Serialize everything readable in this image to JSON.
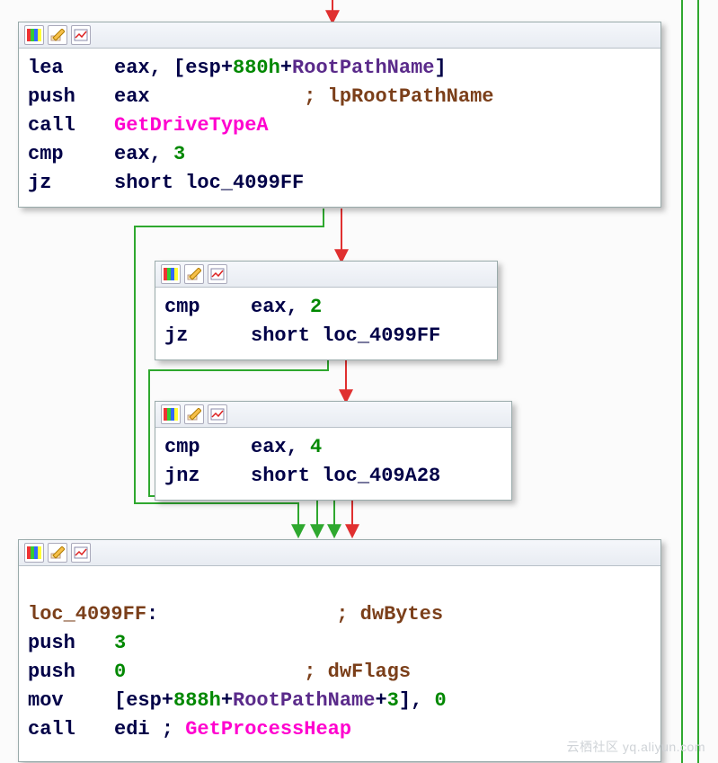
{
  "icons": {
    "colors": "color-bars-icon",
    "edit": "edit-icon",
    "graph": "graph-icon"
  },
  "nodes": {
    "n0": {
      "lines": [
        [
          {
            "t": "lea",
            "c": "mn"
          },
          {
            "t": "eax, [esp+",
            "c": "reg"
          },
          {
            "t": "880h",
            "c": "num"
          },
          {
            "t": "+",
            "c": "reg"
          },
          {
            "t": "RootPathName",
            "c": "vio"
          },
          {
            "t": "]",
            "c": "reg"
          }
        ],
        [
          {
            "t": "push",
            "c": "mn"
          },
          {
            "t": "eax             ",
            "c": "reg"
          },
          {
            "t": "; lpRootPathName",
            "c": "cmt"
          }
        ],
        [
          {
            "t": "call",
            "c": "mn"
          },
          {
            "t": "GetDriveTypeA",
            "c": "api"
          }
        ],
        [
          {
            "t": "cmp",
            "c": "mn"
          },
          {
            "t": "eax, ",
            "c": "reg"
          },
          {
            "t": "3",
            "c": "num"
          }
        ],
        [
          {
            "t": "jz",
            "c": "mn"
          },
          {
            "t": "short loc_4099FF",
            "c": "reg"
          }
        ]
      ]
    },
    "n1": {
      "lines": [
        [
          {
            "t": "cmp",
            "c": "mn"
          },
          {
            "t": "eax, ",
            "c": "reg"
          },
          {
            "t": "2",
            "c": "num"
          }
        ],
        [
          {
            "t": "jz",
            "c": "mn"
          },
          {
            "t": "short loc_4099FF",
            "c": "reg"
          }
        ]
      ]
    },
    "n2": {
      "lines": [
        [
          {
            "t": "cmp",
            "c": "mn"
          },
          {
            "t": "eax, ",
            "c": "reg"
          },
          {
            "t": "4",
            "c": "num"
          }
        ],
        [
          {
            "t": "jnz",
            "c": "mn"
          },
          {
            "t": "short loc_409A28",
            "c": "reg"
          }
        ]
      ]
    },
    "n3": {
      "lines": [
        [
          {
            "t": "",
            "c": ""
          }
        ],
        [
          {
            "t": "loc_4099FF",
            "c": "lbl"
          },
          {
            "t": ":               ",
            "c": "reg"
          },
          {
            "t": "; dwBytes",
            "c": "cmt"
          }
        ],
        [
          {
            "t": "push",
            "c": "mn"
          },
          {
            "t": "3",
            "c": "num"
          }
        ],
        [
          {
            "t": "push",
            "c": "mn"
          },
          {
            "t": "0",
            "c": "num"
          },
          {
            "t": "               ",
            "c": "reg"
          },
          {
            "t": "; dwFlags",
            "c": "cmt"
          }
        ],
        [
          {
            "t": "mov",
            "c": "mn"
          },
          {
            "t": "[esp+",
            "c": "reg"
          },
          {
            "t": "888h",
            "c": "num"
          },
          {
            "t": "+",
            "c": "reg"
          },
          {
            "t": "RootPathName",
            "c": "vio"
          },
          {
            "t": "+",
            "c": "reg"
          },
          {
            "t": "3",
            "c": "num"
          },
          {
            "t": "], ",
            "c": "reg"
          },
          {
            "t": "0",
            "c": "num"
          }
        ],
        [
          {
            "t": "call",
            "c": "mn"
          },
          {
            "t": "edi ; ",
            "c": "reg"
          },
          {
            "t": "GetProcessHeap",
            "c": "api"
          }
        ]
      ]
    }
  },
  "watermark": "云栖社区 yq.aliyun.com"
}
